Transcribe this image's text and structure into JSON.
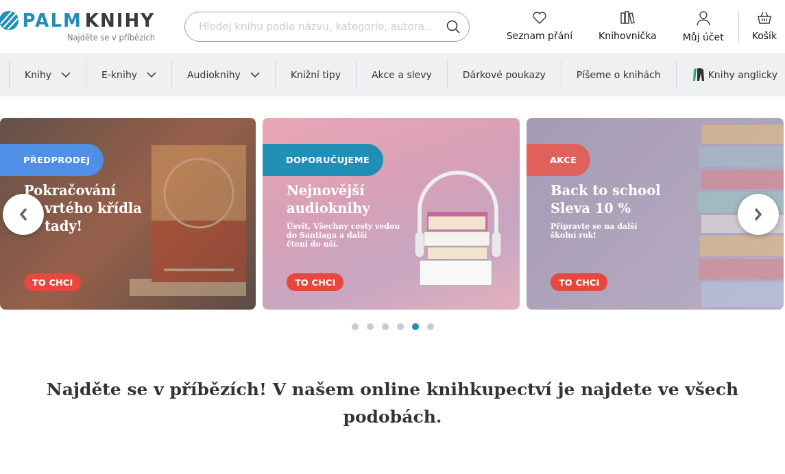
{
  "header": {
    "logo": {
      "brand_a": "PALM",
      "brand_b": "KNIHY",
      "tagline": "Najděte se v příbězích"
    },
    "search": {
      "placeholder": "Hledej knihu podle názvu, kategorie, autora.."
    },
    "actions": [
      {
        "kind": "wishlist",
        "label": "Seznam přání"
      },
      {
        "kind": "library",
        "label": "Knihovnička"
      },
      {
        "kind": "account",
        "label": "Můj účet"
      },
      {
        "kind": "cart",
        "label": "Košík"
      }
    ]
  },
  "nav": [
    {
      "label": "Knihy",
      "has_menu": true,
      "kind": "plain"
    },
    {
      "label": "E-knihy",
      "has_menu": true,
      "kind": "plain"
    },
    {
      "label": "Audioknihy",
      "has_menu": true,
      "kind": "plain"
    },
    {
      "label": "Knižní tipy",
      "has_menu": false,
      "kind": "plain"
    },
    {
      "label": "Akce a slevy",
      "has_menu": false,
      "kind": "plain"
    },
    {
      "label": "Dárkové poukazy",
      "has_menu": false,
      "kind": "plain"
    },
    {
      "label": "Píšeme o knihách",
      "has_menu": false,
      "kind": "plain"
    },
    {
      "label": "Knihy anglicky",
      "has_menu": false,
      "kind": "flag"
    }
  ],
  "carousel": {
    "slides": [
      {
        "active": false,
        "kind": "book",
        "tag": "PŘEDPRODEJ",
        "title": [
          "Pokračování",
          "vrtého křídla",
          "tady!"
        ],
        "button": "TO CHCI"
      },
      {
        "active": true,
        "kind": "audio",
        "tag": "DOPORUČUJEME",
        "title": [
          "Nejnovější",
          "audioknihy"
        ],
        "subtitle": [
          "Úsvit, Všechny cesty vedou",
          "do Santiaga a další",
          "čtení do uší."
        ],
        "button": "TO CHCI"
      },
      {
        "active": false,
        "kind": "stack",
        "tag": "AKCE",
        "title": [
          "Back to school",
          "Sleva 10 %"
        ],
        "subtitle": [
          "Připravte se na další",
          "školní rok!"
        ],
        "button": "TO CHCI"
      }
    ],
    "dots": [
      {
        "selected": false
      },
      {
        "selected": false
      },
      {
        "selected": false
      },
      {
        "selected": false
      },
      {
        "selected": true
      },
      {
        "selected": false
      }
    ]
  },
  "headline": "Najděte se v příbězích! V našem online knihkupectví je najdete ve všech podobách."
}
